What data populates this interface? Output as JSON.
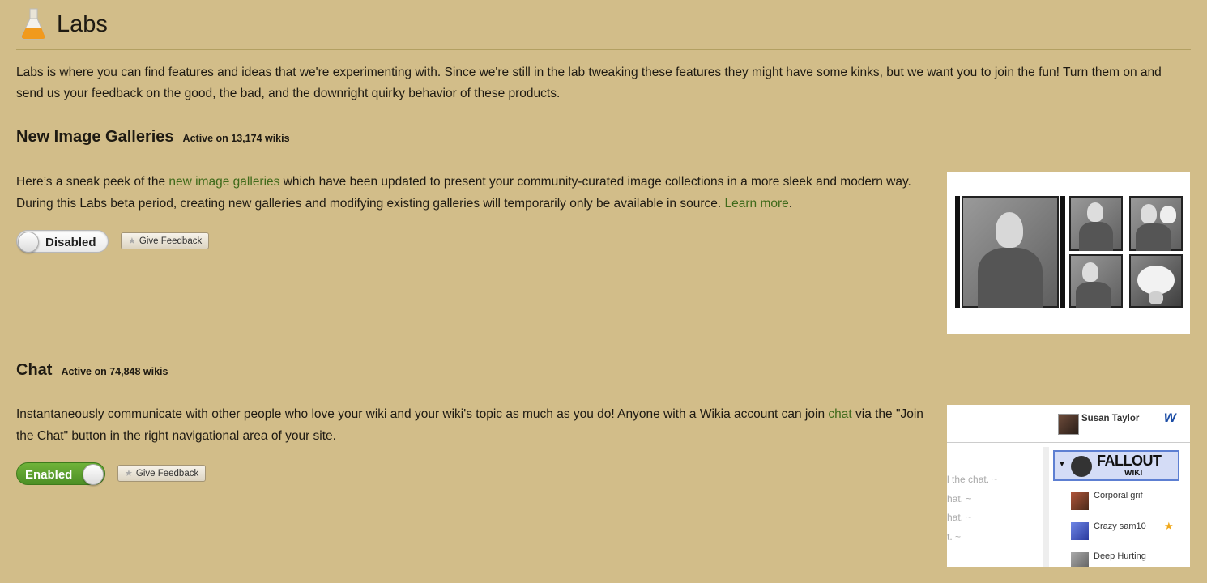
{
  "header": {
    "title": "Labs",
    "icon": "flask-icon"
  },
  "intro": "Labs is where you can find features and ideas that we're experimenting with. Since we're still in the lab tweaking these features they might have some kinks, but we want you to join the fun! Turn them on and send us your feedback on the good, the bad, and the downright quirky behavior of these products.",
  "features": [
    {
      "title": "New Image Galleries",
      "active": "Active on 13,174 wikis",
      "desc_pre": "Here’s a sneak peek of the ",
      "desc_link": "new image galleries",
      "desc_mid": " which have been updated to present your community-curated image collections in a more sleek and modern way. During this Labs beta period, creating new galleries and modifying existing galleries will temporarily only be available in source. ",
      "desc_link2": "Learn more",
      "desc_post": ".",
      "toggle": "Disabled",
      "feedback": "Give Feedback"
    },
    {
      "title": "Chat",
      "active": "Active on 74,848 wikis",
      "desc_pre": "Instantaneously communicate with other people who love your wiki and your wiki's topic as much as you do! Anyone with a Wikia account can join ",
      "desc_link": "chat",
      "desc_post": " via the \"Join the Chat\" button in the right navigational area of your site.",
      "toggle": "Enabled",
      "feedback": "Give Feedback",
      "preview": {
        "user": "Susan Taylor",
        "logo": "w",
        "wiki_title": "FALLOUT",
        "wiki_sub": "WIKI",
        "messages": [
          "l the chat. ~",
          "hat. ~",
          "hat. ~",
          "t. ~"
        ],
        "users": [
          "Corporal grif",
          "Crazy sam10",
          "Deep Hurting"
        ]
      }
    }
  ],
  "colors": {
    "background": "#d2bd89",
    "link": "#3f6a1a",
    "enabled": "#5aa02c",
    "rule": "#b3a062"
  }
}
